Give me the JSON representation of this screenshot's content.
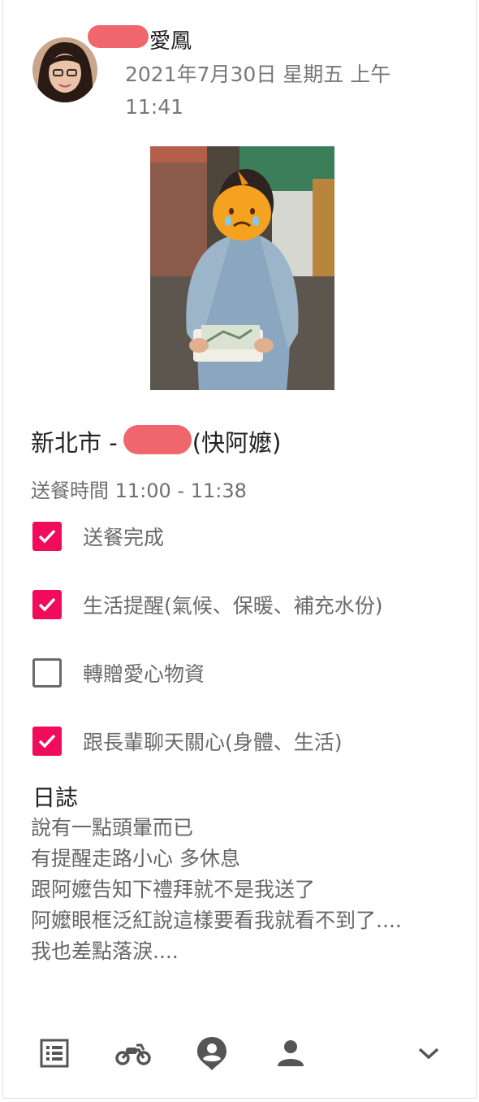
{
  "post": {
    "author_suffix": "愛鳳",
    "date_line1": "2021年7月30日 星期五 上午",
    "date_line2": "11:41",
    "location_prefix": "新北市 -",
    "location_suffix": "(快阿嬤)",
    "delivery_time": "送餐時間 11:00 - 11:38"
  },
  "checklist": [
    {
      "label": "送餐完成",
      "checked": true
    },
    {
      "label": "生活提醒(氣候、保暖、補充水份)",
      "checked": true
    },
    {
      "label": "轉贈愛心物資",
      "checked": false
    },
    {
      "label": "跟長輩聊天關心(身體、生活)",
      "checked": true
    }
  ],
  "log": {
    "title": "日誌",
    "lines": [
      "說有一點頭暈而已",
      "有提醒走路小心 多休息",
      "跟阿嬤告知下禮拜就不是我送了",
      "阿嬤眼框泛紅說這樣要看我就看不到了....",
      "我也差點落淚...."
    ]
  },
  "nav": [
    {
      "icon": "list-icon"
    },
    {
      "icon": "motorcycle-icon"
    },
    {
      "icon": "location-person-icon"
    },
    {
      "icon": "person-icon"
    },
    {
      "icon": "chevron-down-icon"
    }
  ],
  "colors": {
    "accent": "#f00b5b",
    "redaction": "#ee5a5f"
  }
}
